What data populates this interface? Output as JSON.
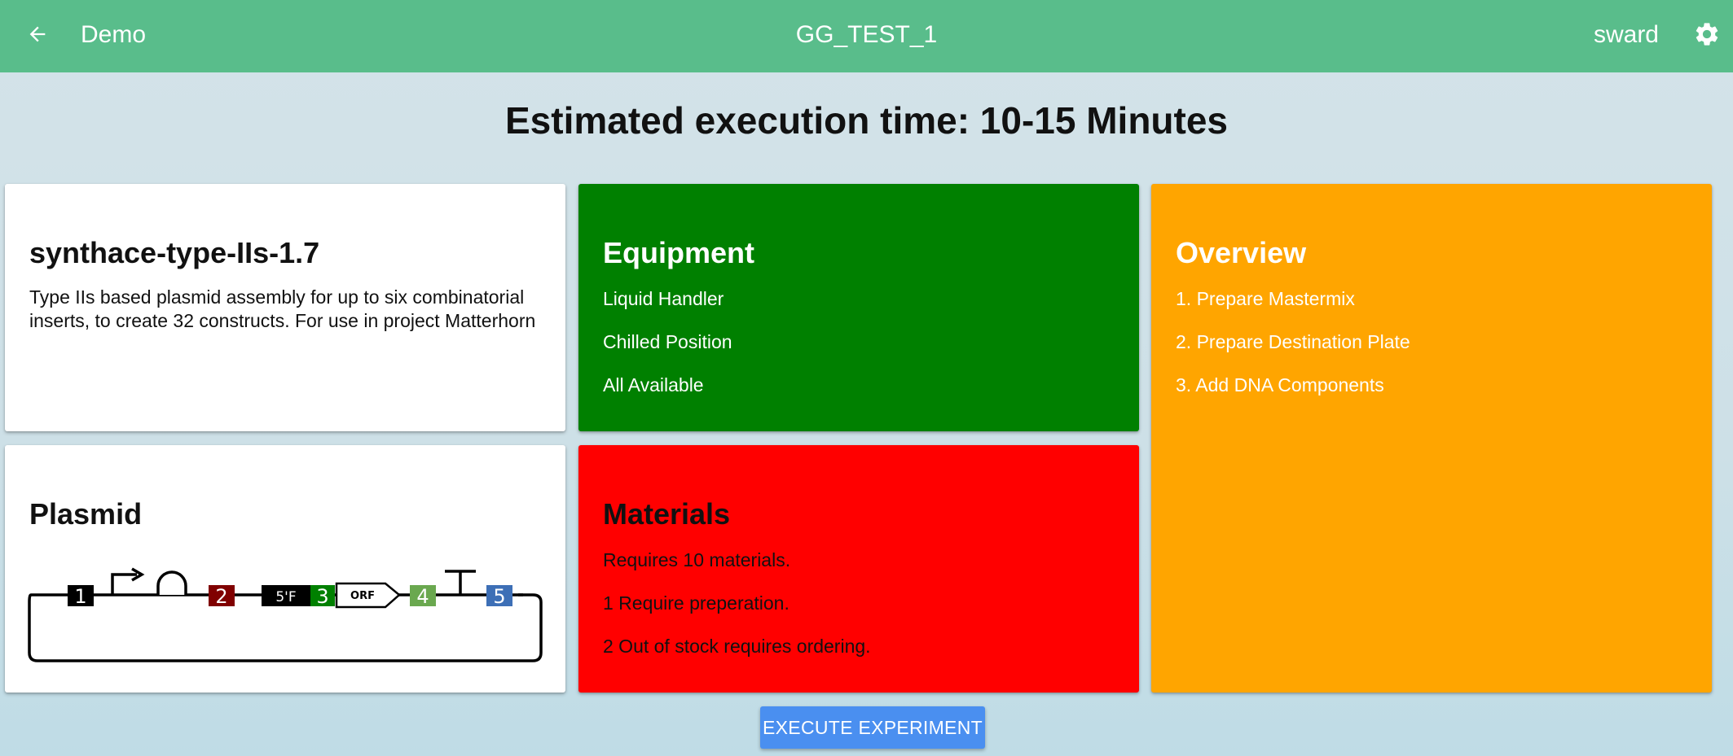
{
  "appbar": {
    "app_name": "Demo",
    "experiment_name": "GG_TEST_1",
    "user": "sward",
    "icons": {
      "back": "arrow-left-icon",
      "settings": "gear-icon"
    },
    "color": "#59bd8b"
  },
  "headline": "Estimated execution time: 10-15 Minutes",
  "protocol": {
    "title": "synthace-type-IIs-1.7",
    "description": "Type IIs based plasmid assembly for up to six combinatorial inserts, to create 32 constructs. For use in project Matterhorn"
  },
  "equipment": {
    "title": "Equipment",
    "items": [
      "Liquid Handler",
      "Chilled Position",
      "All Available"
    ],
    "color": "#008000"
  },
  "overview": {
    "title": "Overview",
    "items": [
      "1. Prepare Mastermix",
      "2. Prepare Destination Plate",
      "3. Add DNA Components"
    ],
    "color": "#ffa500"
  },
  "plasmid": {
    "title": "Plasmid",
    "parts": [
      {
        "label": "1",
        "color": "#000000"
      },
      {
        "label": "2",
        "color": "#800000"
      },
      {
        "label": "5'F",
        "color": "#000000"
      },
      {
        "label": "3",
        "color": "#008000"
      },
      {
        "label": "ORF",
        "color": "#ffffff"
      },
      {
        "label": "4",
        "color": "#6aa84f"
      },
      {
        "label": "5",
        "color": "#3d6fb6"
      }
    ]
  },
  "materials": {
    "title": "Materials",
    "items": [
      "Requires 10 materials.",
      "1 Require preperation.",
      "2 Out of stock requires ordering."
    ],
    "color": "#ff0000"
  },
  "actions": {
    "execute_label": "EXECUTE EXPERIMENT"
  }
}
